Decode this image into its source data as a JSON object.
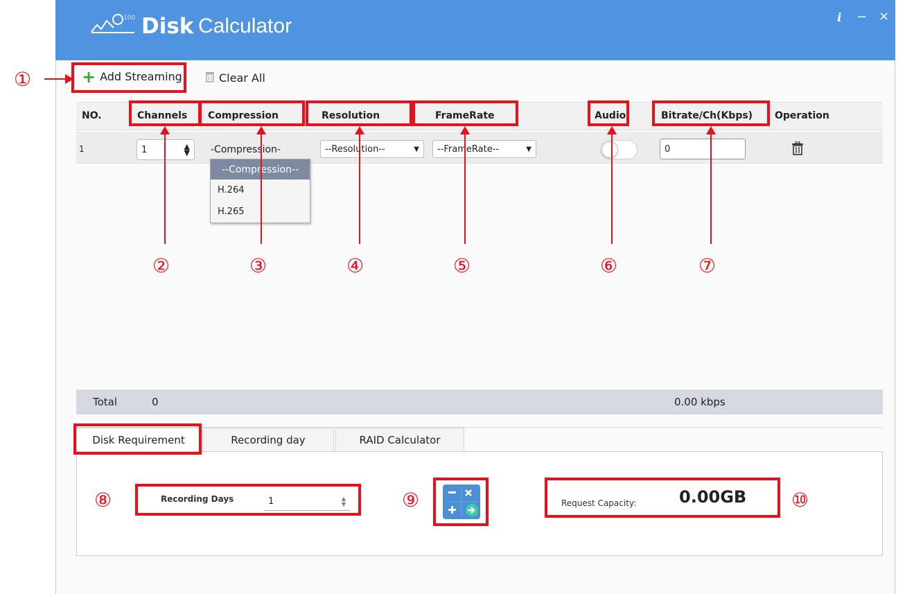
{
  "window": {
    "title_bold": "Disk",
    "title_light": "Calculator",
    "info_label": "i",
    "minimize_label": "−",
    "close_label": "×"
  },
  "toolbar": {
    "add_label": "Add Streaming",
    "clear_label": "Clear All"
  },
  "table": {
    "headers": {
      "no": "NO.",
      "channels": "Channels",
      "compression": "Compression",
      "resolution": "Resolution",
      "framerate": "FrameRate",
      "audio": "Audio",
      "bitrate": "Bitrate/Ch(Kbps)",
      "operation": "Operation"
    },
    "rows": [
      {
        "no": "1",
        "channels": "1",
        "compression": "-Compression-",
        "resolution": "--Resolution--",
        "framerate": "--FrameRate--",
        "bitrate": "0"
      }
    ],
    "compression_options": [
      "--Compression--",
      "H.264",
      "H.265"
    ],
    "total_label": "Total",
    "total_value": "0",
    "total_bitrate": "0.00 kbps"
  },
  "tabs": [
    "Disk Requirement",
    "Recording day",
    "RAID Calculator"
  ],
  "disk": {
    "recording_days_label": "Recording Days",
    "recording_days_value": "1",
    "capacity_label": "Request Capacity:",
    "capacity_value": "0.00GB"
  },
  "annotations": [
    "①",
    "②",
    "③",
    "④",
    "⑤",
    "⑥",
    "⑦",
    "⑧",
    "⑨",
    "⑩"
  ],
  "colors": {
    "titlebar": "#4f94e0",
    "annotation_red": "#e8101a",
    "add_icon_green": "#2fa836"
  }
}
